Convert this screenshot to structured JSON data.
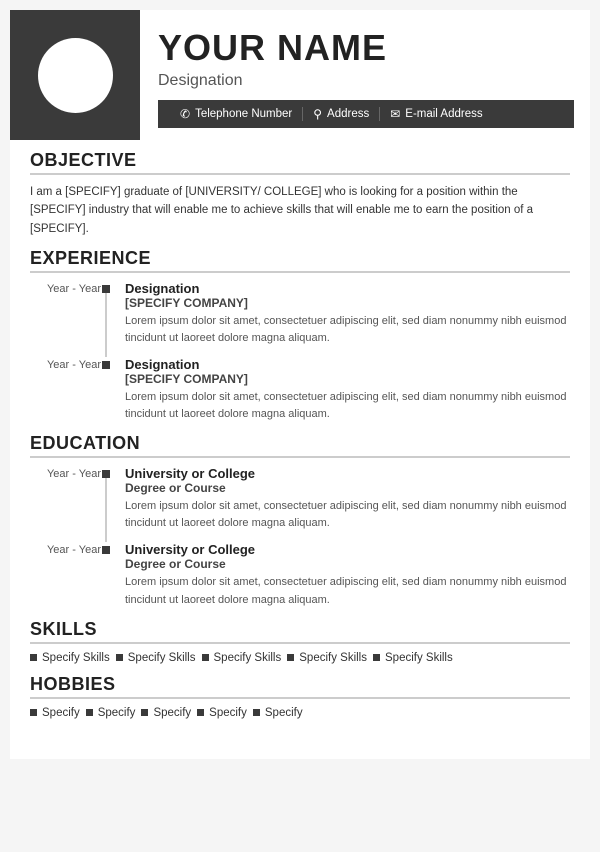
{
  "header": {
    "name": "YOUR NAME",
    "designation": "Designation",
    "contact": {
      "phone_icon": "📞",
      "phone": "Telephone Number",
      "address_icon": "📍",
      "address": "Address",
      "email_icon": "✉",
      "email": "E-mail Address"
    }
  },
  "sections": {
    "objective": {
      "title": "OBJECTIVE",
      "text": "I am a [SPECIFY] graduate of [UNIVERSITY/ COLLEGE] who is looking for a position within the [SPECIFY] industry that will enable me to achieve skills that will enable me to earn the position of a [SPECIFY]."
    },
    "experience": {
      "title": "EXPERIENCE",
      "items": [
        {
          "years": "Year - Year",
          "role": "Designation",
          "company": "[SPECIFY COMPANY]",
          "desc": "Lorem ipsum dolor sit amet, consectetuer adipiscing elit, sed diam nonummy nibh euismod tincidunt ut laoreet dolore magna aliquam."
        },
        {
          "years": "Year - Year",
          "role": "Designation",
          "company": "[SPECIFY COMPANY]",
          "desc": "Lorem ipsum dolor sit amet, consectetuer adipiscing elit, sed diam nonummy nibh euismod tincidunt ut laoreet dolore magna aliquam."
        }
      ]
    },
    "education": {
      "title": "EDUCATION",
      "items": [
        {
          "years": "Year - Year",
          "school": "University or College",
          "degree": "Degree or Course",
          "desc": "Lorem ipsum dolor sit amet, consectetuer adipiscing elit, sed diam nonummy nibh euismod tincidunt ut laoreet dolore magna aliquam."
        },
        {
          "years": "Year - Year",
          "school": "University or College",
          "degree": "Degree or Course",
          "desc": "Lorem ipsum dolor sit amet, consectetuer adipiscing elit, sed diam nonummy nibh euismod tincidunt ut laoreet dolore magna aliquam."
        }
      ]
    },
    "skills": {
      "title": "SKILLS",
      "items": [
        "Specify Skills",
        "Specify Skills",
        "Specify Skills",
        "Specify Skills",
        "Specify Skills"
      ]
    },
    "hobbies": {
      "title": "HOBBIES",
      "items": [
        "Specify",
        "Specify",
        "Specify",
        "Specify",
        "Specify"
      ]
    }
  }
}
